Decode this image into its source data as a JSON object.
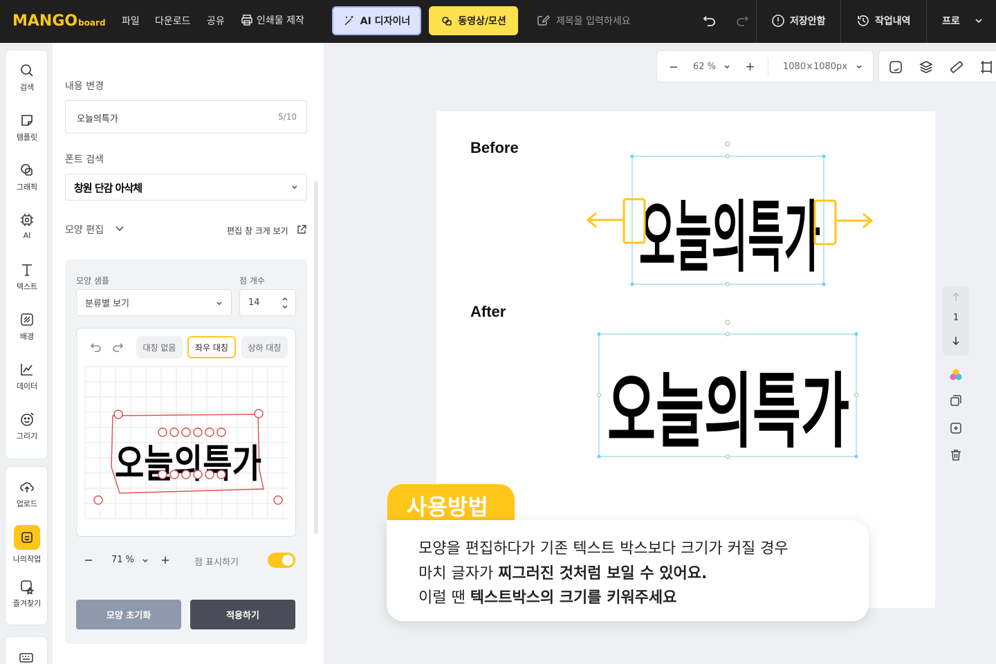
{
  "app": {
    "logo_main": "MANGO",
    "logo_sub": "board"
  },
  "topbar": {
    "menu": [
      "파일",
      "다운로드",
      "공유",
      "인쇄물 제작"
    ],
    "ai_label": "AI 디자이너",
    "video_label": "동영상/모션",
    "title_placeholder": "제목을 입력하세요",
    "save_status": "저장안함",
    "history": "작업내역",
    "plan": "프로"
  },
  "rail": {
    "items": [
      "검색",
      "템플릿",
      "그래픽",
      "AI",
      "텍스트",
      "배경",
      "데이터",
      "그리기"
    ],
    "items2": [
      "업로드",
      "나의작업",
      "즐겨찾기"
    ]
  },
  "panel": {
    "content_label": "내용 변경",
    "content_value": "오늘의특가",
    "content_count": "5/10",
    "font_label": "폰트 검색",
    "font_value": "창원 단감 아삭체",
    "shape_edit_label": "모양 편집",
    "open_large": "편집 창 크게 보기",
    "sample_label": "모양 샘플",
    "sample_value": "분류별 보기",
    "points_label": "점 개수",
    "points_value": "14",
    "sym_none": "대칭 없음",
    "sym_lr": "좌우 대칭",
    "sym_tb": "상하 대칭",
    "zoom_value": "71 %",
    "show_points": "점 표시하기",
    "reset": "모양 초기화",
    "apply": "적용하기"
  },
  "zoombar": {
    "zoom": "62 %",
    "size": "1080×1080px"
  },
  "canvas": {
    "before": "Before",
    "after": "After",
    "art_text": "오늘의특가"
  },
  "pager": {
    "page": "1"
  },
  "callout": {
    "tab": "사용방법",
    "line1": "모양을 편집하다가 기존 텍스트 박스보다 크기가 커질 경우",
    "line2_a": "마치 글자가 ",
    "line2_b": "찌그러진 것처럼 보일 수 있어요.",
    "line3_a": "이럴 땐 ",
    "line3_b": "텍스트박스의 크기를 키워주세요"
  },
  "colors": {
    "accent": "#ffc61a",
    "topbar": "#1f1f1f",
    "selection": "#6fd3e0",
    "warp_handle": "#e05555"
  }
}
